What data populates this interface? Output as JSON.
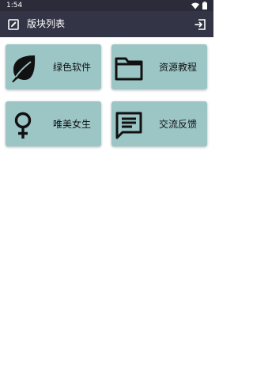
{
  "status_bar": {
    "time": "1:54"
  },
  "app_bar": {
    "title": "版块列表",
    "left_icon": "edit-square-icon",
    "right_icon": "exit-icon",
    "background": "#333446"
  },
  "cards": [
    {
      "label": "绿色软件",
      "icon": "leaf-icon"
    },
    {
      "label": "资源教程",
      "icon": "folder-icon"
    },
    {
      "label": "唯美女生",
      "icon": "female-symbol-icon"
    },
    {
      "label": "交流反馈",
      "icon": "chat-message-icon"
    }
  ],
  "colors": {
    "card_background": "#9cc5c5",
    "status_bar": "#2b2b3a",
    "icon": "#111111"
  }
}
